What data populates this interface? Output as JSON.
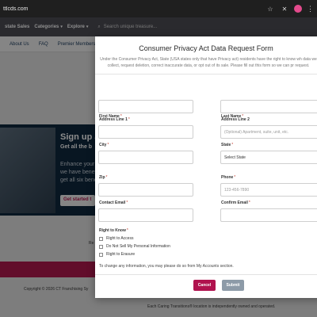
{
  "browser": {
    "url": "ttlcds.com"
  },
  "site_nav": {
    "items": [
      "state Sales",
      "Categories",
      "Explore"
    ],
    "search_placeholder": "Search unique treasure..."
  },
  "sub_nav": {
    "items": [
      "About Us",
      "FAQ",
      "Premier Members"
    ]
  },
  "background": {
    "heading": "Sign up a",
    "subheading": "Get all the b",
    "body_lines": [
      "Enhance your",
      "we have benef",
      "get all six bene"
    ],
    "cta": "Get started t",
    "side_text": "Re",
    "copyright": "Copyright © 2026 CT Franchising Sy",
    "locations": "Each Caring Transitions® location is independently owned and operated."
  },
  "modal": {
    "title": "Consumer Privacy Act Data Request Form",
    "description": "Under the Consumer Privacy Act, State (USA states only that have Privacy act) residents have the right to know wh data we collect, request deletion, correct inaccurate data, or opt out of its sale. Please fill out this form so we can pr request.",
    "fields": {
      "first_name": {
        "label": "First Name",
        "required": "*",
        "value": ""
      },
      "last_name": {
        "label": "Last Name",
        "required": "*",
        "value": ""
      },
      "address1": {
        "label": "Address Line 1",
        "required": "*",
        "value": ""
      },
      "address2": {
        "label": "Address Line 2",
        "placeholder": "(Optional) Apartment, suite, unit, etc."
      },
      "city": {
        "label": "City",
        "required": "*",
        "value": ""
      },
      "state": {
        "label": "State",
        "required": "*",
        "selected": "Select State"
      },
      "zip": {
        "label": "Zip",
        "required": "*",
        "value": ""
      },
      "phone": {
        "label": "Phone",
        "required": "*",
        "placeholder": "123-456-7890"
      },
      "contact_email": {
        "label": "Contact Email",
        "required": "*",
        "value": ""
      },
      "confirm_email": {
        "label": "Confirm Email",
        "required": "*",
        "value": ""
      }
    },
    "right_to_know": {
      "label": "Right to Know",
      "required": "*",
      "options": [
        "Right to Access",
        "Do Not Sell My Personal Information",
        "Right to Erasure"
      ]
    },
    "note": "To change any information, you may please do so from My Accounts section.",
    "buttons": {
      "cancel": "Cancel",
      "submit": "Submit"
    }
  },
  "colors": {
    "cancel": "#b0124e",
    "submit": "#8d9ba8",
    "nav": "#4d4d55",
    "banner": "#10283f",
    "accent_pink": "#b2184f"
  }
}
